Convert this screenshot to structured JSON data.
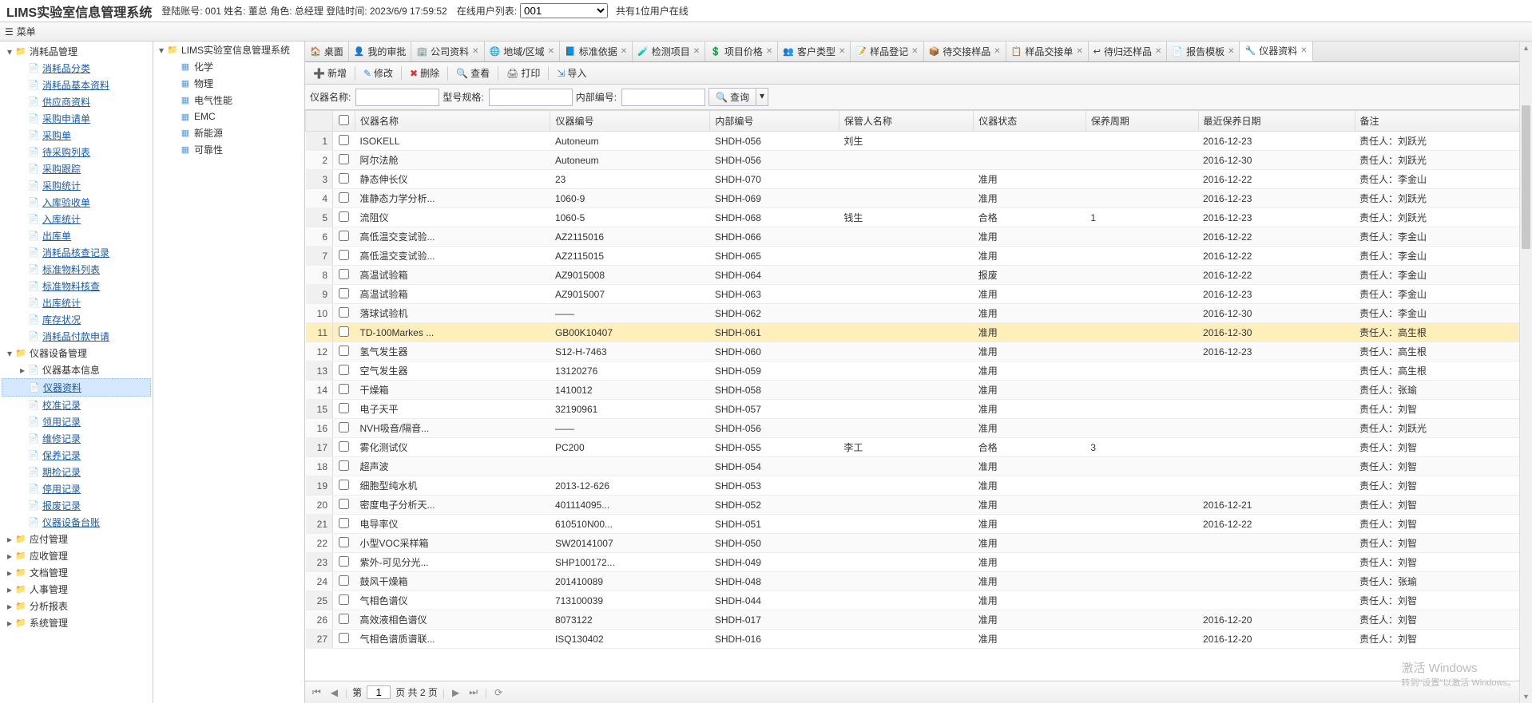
{
  "app_title": "LIMS实验室信息管理系统",
  "header_info": "登陆账号: 001 姓名: 董总 角色: 总经理 登陆时间: 2023/6/9 17:59:52",
  "online_label": "在线用户列表:",
  "online_select": "001",
  "online_count": "共有1位用户在线",
  "menu_label": "菜单",
  "left_tree": [
    {
      "indent": 0,
      "toggle": "▾",
      "icon": "📁",
      "cls": "folder-icon",
      "label": "消耗品管理",
      "plain": true
    },
    {
      "indent": 1,
      "toggle": "",
      "icon": "📄",
      "cls": "doc-icon",
      "label": "消耗品分类"
    },
    {
      "indent": 1,
      "toggle": "",
      "icon": "📄",
      "cls": "doc-icon",
      "label": "消耗品基本资料"
    },
    {
      "indent": 1,
      "toggle": "",
      "icon": "📄",
      "cls": "doc-icon",
      "label": "供应商资料"
    },
    {
      "indent": 1,
      "toggle": "",
      "icon": "📄",
      "cls": "doc-icon",
      "label": "采购申请单"
    },
    {
      "indent": 1,
      "toggle": "",
      "icon": "📄",
      "cls": "doc-icon",
      "label": "采购单"
    },
    {
      "indent": 1,
      "toggle": "",
      "icon": "📄",
      "cls": "doc-icon",
      "label": "待采购列表"
    },
    {
      "indent": 1,
      "toggle": "",
      "icon": "📄",
      "cls": "doc-icon",
      "label": "采购跟踪"
    },
    {
      "indent": 1,
      "toggle": "",
      "icon": "📄",
      "cls": "doc-icon",
      "label": "采购统计"
    },
    {
      "indent": 1,
      "toggle": "",
      "icon": "📄",
      "cls": "doc-icon",
      "label": "入库验收单"
    },
    {
      "indent": 1,
      "toggle": "",
      "icon": "📄",
      "cls": "doc-icon",
      "label": "入库统计"
    },
    {
      "indent": 1,
      "toggle": "",
      "icon": "📄",
      "cls": "doc-icon",
      "label": "出库单"
    },
    {
      "indent": 1,
      "toggle": "",
      "icon": "📄",
      "cls": "doc-icon",
      "label": "消耗品核查记录"
    },
    {
      "indent": 1,
      "toggle": "",
      "icon": "📄",
      "cls": "doc-icon",
      "label": "标准物料列表"
    },
    {
      "indent": 1,
      "toggle": "",
      "icon": "📄",
      "cls": "doc-icon",
      "label": "标准物料核查"
    },
    {
      "indent": 1,
      "toggle": "",
      "icon": "📄",
      "cls": "doc-icon",
      "label": "出库统计"
    },
    {
      "indent": 1,
      "toggle": "",
      "icon": "📄",
      "cls": "doc-icon",
      "label": "库存状况"
    },
    {
      "indent": 1,
      "toggle": "",
      "icon": "📄",
      "cls": "doc-icon",
      "label": "消耗品付款申请"
    },
    {
      "indent": 0,
      "toggle": "▾",
      "icon": "📁",
      "cls": "folder-icon",
      "label": "仪器设备管理",
      "plain": true
    },
    {
      "indent": 1,
      "toggle": "▸",
      "icon": "📄",
      "cls": "doc-icon",
      "label": "仪器基本信息",
      "plain": true
    },
    {
      "indent": 1,
      "toggle": "",
      "icon": "📄",
      "cls": "doc-icon",
      "label": "仪器资料",
      "selected": true
    },
    {
      "indent": 1,
      "toggle": "",
      "icon": "📄",
      "cls": "doc-icon",
      "label": "校准记录"
    },
    {
      "indent": 1,
      "toggle": "",
      "icon": "📄",
      "cls": "doc-icon",
      "label": "领用记录"
    },
    {
      "indent": 1,
      "toggle": "",
      "icon": "📄",
      "cls": "doc-icon",
      "label": "维修记录"
    },
    {
      "indent": 1,
      "toggle": "",
      "icon": "📄",
      "cls": "doc-icon",
      "label": "保养记录"
    },
    {
      "indent": 1,
      "toggle": "",
      "icon": "📄",
      "cls": "doc-icon",
      "label": "期检记录"
    },
    {
      "indent": 1,
      "toggle": "",
      "icon": "📄",
      "cls": "doc-icon",
      "label": "停用记录"
    },
    {
      "indent": 1,
      "toggle": "",
      "icon": "📄",
      "cls": "doc-icon",
      "label": "报废记录"
    },
    {
      "indent": 1,
      "toggle": "",
      "icon": "📄",
      "cls": "doc-icon",
      "label": "仪器设备台账"
    },
    {
      "indent": 0,
      "toggle": "▸",
      "icon": "📁",
      "cls": "folder-icon",
      "label": "应付管理",
      "plain": true
    },
    {
      "indent": 0,
      "toggle": "▸",
      "icon": "📁",
      "cls": "folder-icon",
      "label": "应收管理",
      "plain": true
    },
    {
      "indent": 0,
      "toggle": "▸",
      "icon": "📁",
      "cls": "folder-icon",
      "label": "文档管理",
      "plain": true
    },
    {
      "indent": 0,
      "toggle": "▸",
      "icon": "📁",
      "cls": "folder-icon",
      "label": "人事管理",
      "plain": true
    },
    {
      "indent": 0,
      "toggle": "▸",
      "icon": "📁",
      "cls": "folder-icon",
      "label": "分析报表",
      "plain": true
    },
    {
      "indent": 0,
      "toggle": "▸",
      "icon": "📁",
      "cls": "folder-icon",
      "label": "系统管理",
      "plain": true
    }
  ],
  "mid_tree_root": "LIMS实验室信息管理系统",
  "mid_tree": [
    "化学",
    "物理",
    "电气性能",
    "EMC",
    "新能源",
    "可靠性"
  ],
  "tabs": [
    {
      "icon": "🏠",
      "label": "桌面"
    },
    {
      "icon": "👤",
      "label": "我的审批"
    },
    {
      "icon": "🏢",
      "label": "公司资料",
      "close": true
    },
    {
      "icon": "🌐",
      "label": "地域/区域",
      "close": true
    },
    {
      "icon": "📘",
      "label": "标准依据",
      "close": true
    },
    {
      "icon": "🧪",
      "label": "检测项目",
      "close": true
    },
    {
      "icon": "💲",
      "label": "项目价格",
      "close": true
    },
    {
      "icon": "👥",
      "label": "客户类型",
      "close": true
    },
    {
      "icon": "📝",
      "label": "样品登记",
      "close": true
    },
    {
      "icon": "📦",
      "label": "待交接样品",
      "close": true
    },
    {
      "icon": "📋",
      "label": "样品交接单",
      "close": true
    },
    {
      "icon": "↩",
      "label": "待归还样品",
      "close": true
    },
    {
      "icon": "📄",
      "label": "报告模板",
      "close": true
    },
    {
      "icon": "🔧",
      "label": "仪器资料",
      "close": true,
      "active": true
    }
  ],
  "toolbar": [
    {
      "icon": "➕",
      "label": "新增",
      "color": "#2a8"
    },
    {
      "icon": "✎",
      "label": "修改",
      "color": "#38f"
    },
    {
      "icon": "✖",
      "label": "删除",
      "color": "#d33"
    },
    {
      "icon": "🔍",
      "label": "查看",
      "color": "#38f"
    },
    {
      "icon": "🖨",
      "label": "打印",
      "color": "#666"
    },
    {
      "icon": "⇲",
      "label": "导入",
      "color": "#38f"
    }
  ],
  "search": {
    "name_label": "仪器名称:",
    "model_label": "型号规格:",
    "code_label": "内部编号:",
    "btn": "查询"
  },
  "columns": [
    "",
    "",
    "仪器名称",
    "仪器编号",
    "内部编号",
    "保管人名称",
    "仪器状态",
    "保养周期",
    "最近保养日期",
    "备注"
  ],
  "rows": [
    [
      "1",
      "ISOKELL",
      "Autoneum",
      "SHDH-056",
      "刘生",
      "",
      "",
      "2016-12-23",
      "责任人：刘跃光"
    ],
    [
      "2",
      "阿尔法舱",
      "Autoneum",
      "SHDH-056",
      "",
      "",
      "",
      "2016-12-30",
      "责任人：刘跃光"
    ],
    [
      "3",
      "静态伸长仪",
      "23",
      "SHDH-070",
      "",
      "准用",
      "",
      "2016-12-22",
      "责任人：李金山"
    ],
    [
      "4",
      "准静态力学分析...",
      "1060-9",
      "SHDH-069",
      "",
      "准用",
      "",
      "2016-12-23",
      "责任人：刘跃光"
    ],
    [
      "5",
      "流阻仪",
      "1060-5",
      "SHDH-068",
      "钱生",
      "合格",
      "1",
      "2016-12-23",
      "责任人：刘跃光"
    ],
    [
      "6",
      "高低温交变试验...",
      "AZ2115016",
      "SHDH-066",
      "",
      "准用",
      "",
      "2016-12-22",
      "责任人：李金山"
    ],
    [
      "7",
      "高低温交变试验...",
      "AZ2115015",
      "SHDH-065",
      "",
      "准用",
      "",
      "2016-12-22",
      "责任人：李金山"
    ],
    [
      "8",
      "高温试验箱",
      "AZ9015008",
      "SHDH-064",
      "",
      "报废",
      "",
      "2016-12-22",
      "责任人：李金山"
    ],
    [
      "9",
      "高温试验箱",
      "AZ9015007",
      "SHDH-063",
      "",
      "准用",
      "",
      "2016-12-23",
      "责任人：李金山"
    ],
    [
      "10",
      "落球试验机",
      "——",
      "SHDH-062",
      "",
      "准用",
      "",
      "2016-12-30",
      "责任人：李金山"
    ],
    [
      "11",
      "TD-100Markes ...",
      "GB00K10407",
      "SHDH-061",
      "",
      "准用",
      "",
      "2016-12-30",
      "责任人：高生根"
    ],
    [
      "12",
      "氢气发生器",
      "S12-H-7463",
      "SHDH-060",
      "",
      "准用",
      "",
      "2016-12-23",
      "责任人：高生根"
    ],
    [
      "13",
      "空气发生器",
      "13120276",
      "SHDH-059",
      "",
      "准用",
      "",
      "",
      "责任人：高生根"
    ],
    [
      "14",
      "干燥箱",
      "1410012",
      "SHDH-058",
      "",
      "准用",
      "",
      "",
      "责任人：张瑜"
    ],
    [
      "15",
      "电子天平",
      "32190961",
      "SHDH-057",
      "",
      "准用",
      "",
      "",
      "责任人：刘智"
    ],
    [
      "16",
      "NVH吸音/隔音...",
      "——",
      "SHDH-056",
      "",
      "准用",
      "",
      "",
      "责任人：刘跃光"
    ],
    [
      "17",
      "雾化测试仪",
      "PC200",
      "SHDH-055",
      "李工",
      "合格",
      "3",
      "",
      "责任人：刘智"
    ],
    [
      "18",
      "超声波",
      "",
      "SHDH-054",
      "",
      "准用",
      "",
      "",
      "责任人：刘智"
    ],
    [
      "19",
      "细胞型纯水机",
      "2013-12-626",
      "SHDH-053",
      "",
      "准用",
      "",
      "",
      "责任人：刘智"
    ],
    [
      "20",
      "密度电子分析天...",
      "401114095...",
      "SHDH-052",
      "",
      "准用",
      "",
      "2016-12-21",
      "责任人：刘智"
    ],
    [
      "21",
      "电导率仪",
      "610510N00...",
      "SHDH-051",
      "",
      "准用",
      "",
      "2016-12-22",
      "责任人：刘智"
    ],
    [
      "22",
      "小型VOC采样箱",
      "SW20141007",
      "SHDH-050",
      "",
      "准用",
      "",
      "",
      "责任人：刘智"
    ],
    [
      "23",
      "紫外-可见分光...",
      "SHP100172...",
      "SHDH-049",
      "",
      "准用",
      "",
      "",
      "责任人：刘智"
    ],
    [
      "24",
      "鼓风干燥箱",
      "201410089",
      "SHDH-048",
      "",
      "准用",
      "",
      "",
      "责任人：张瑜"
    ],
    [
      "25",
      "气相色谱仪",
      "713100039",
      "SHDH-044",
      "",
      "准用",
      "",
      "",
      "责任人：刘智"
    ],
    [
      "26",
      "高效液相色谱仪",
      "8073122",
      "SHDH-017",
      "",
      "准用",
      "",
      "2016-12-20",
      "责任人：刘智"
    ],
    [
      "27",
      "气相色谱质谱联...",
      "ISQ130402",
      "SHDH-016",
      "",
      "准用",
      "",
      "2016-12-20",
      "责任人：刘智"
    ]
  ],
  "pager": {
    "page": "1",
    "total_label": "页 共 2 页"
  },
  "watermark": {
    "line1": "激活 Windows",
    "line2": "转到\"设置\"以激活 Windows。"
  }
}
